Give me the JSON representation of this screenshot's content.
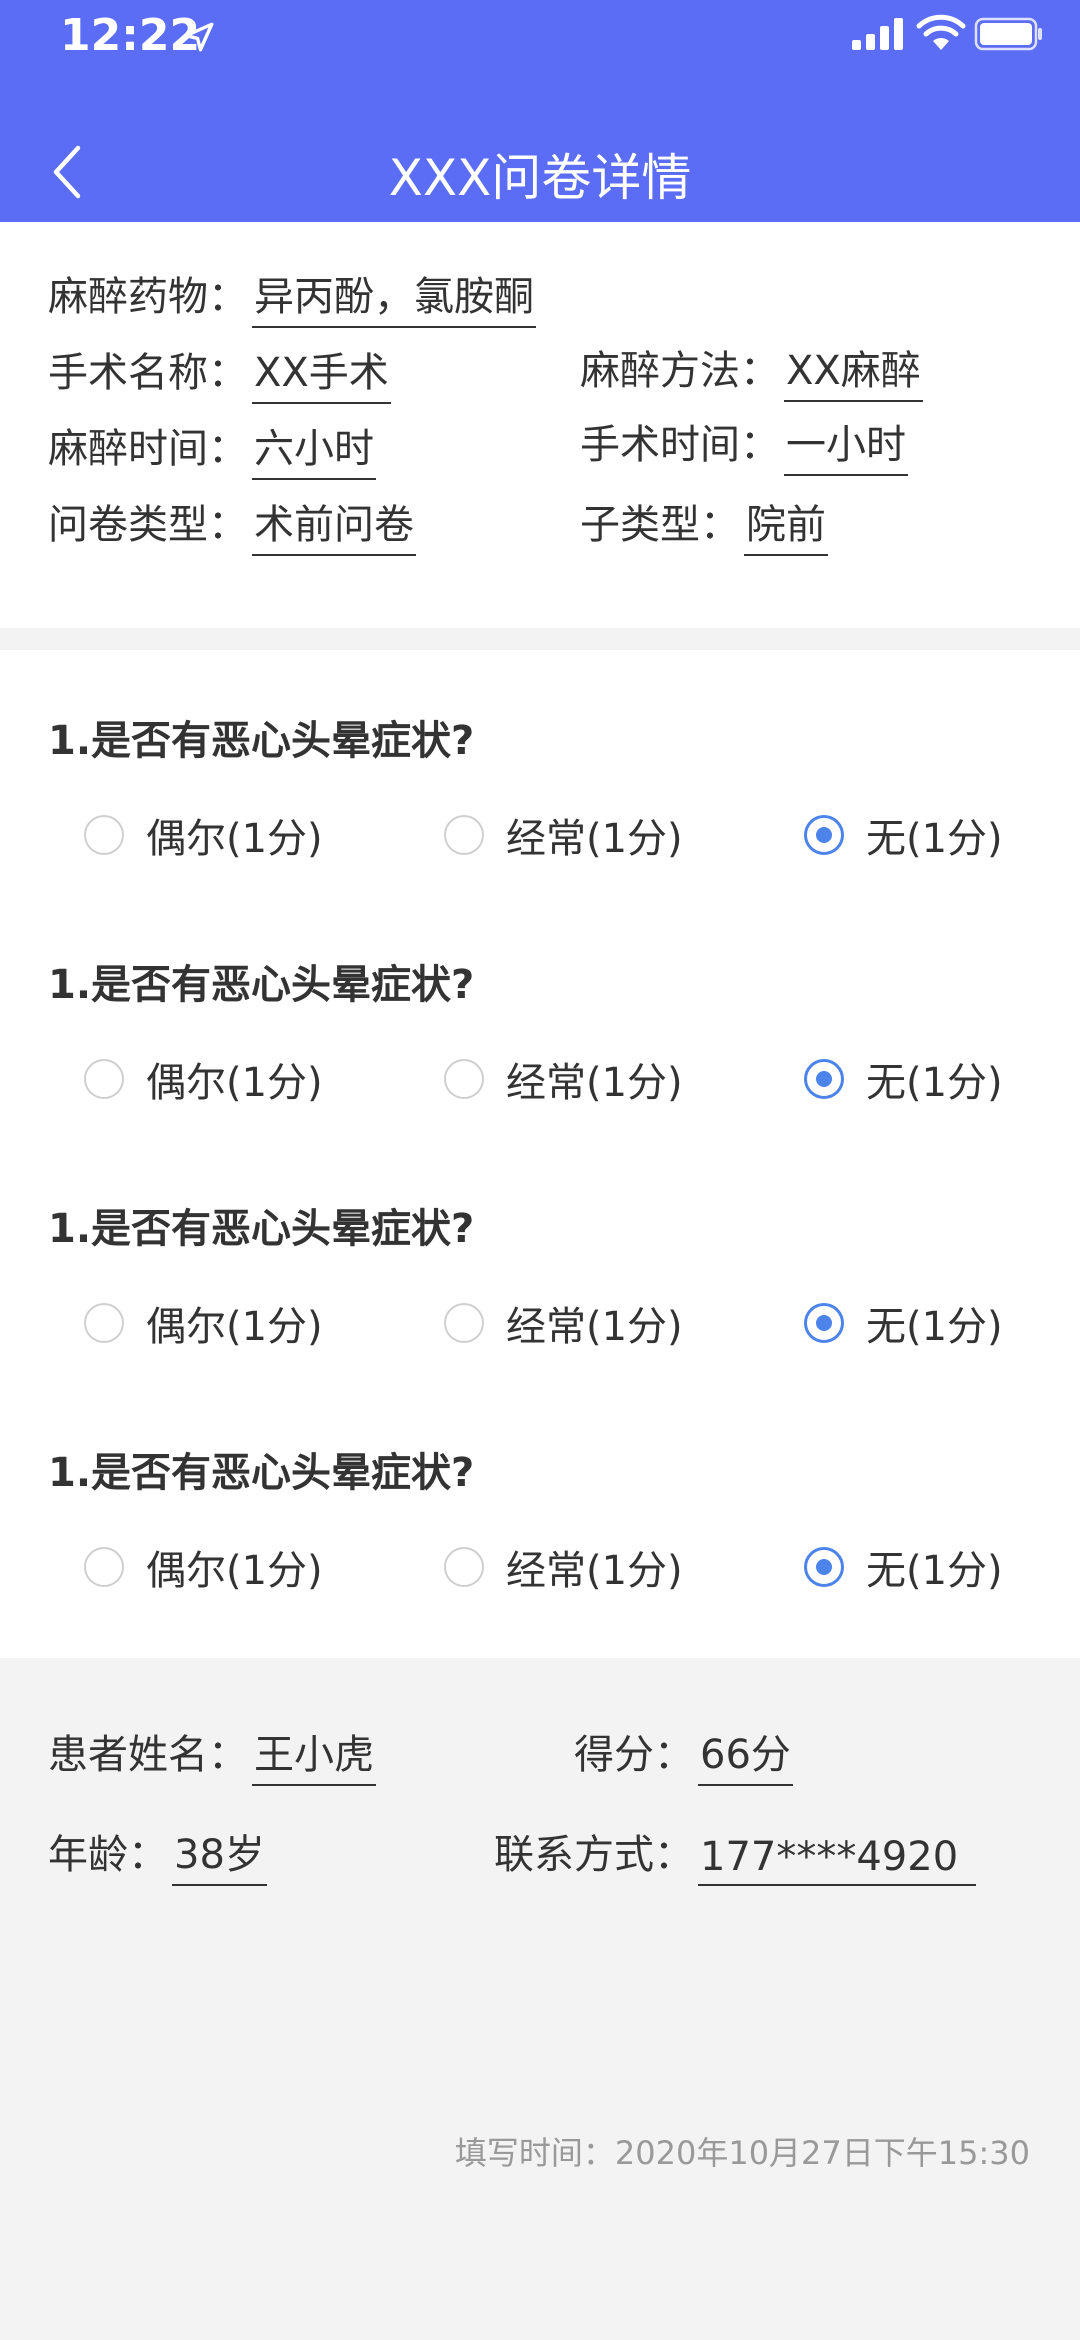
{
  "status_bar": {
    "time": "12:22"
  },
  "header": {
    "title": "XXX问卷详情"
  },
  "info": {
    "drug": {
      "label": "麻醉药物：",
      "value": "异丙酚，氯胺酮"
    },
    "surgery_name": {
      "label": "手术名称：",
      "value": "XX手术"
    },
    "anesthesia_method": {
      "label": "麻醉方法：",
      "value": "XX麻醉"
    },
    "anesthesia_time": {
      "label": "麻醉时间：",
      "value": "六小时"
    },
    "surgery_time": {
      "label": "手术时间：",
      "value": "一小时"
    },
    "questionnaire_type": {
      "label": "问卷类型：",
      "value": "术前问卷"
    },
    "subtype": {
      "label": "子类型：",
      "value": "院前"
    }
  },
  "questions": [
    {
      "text": "1.是否有恶心头晕症状?",
      "options": [
        "偶尔(1分)",
        "经常(1分)",
        "无(1分)"
      ],
      "selected": 2
    },
    {
      "text": "1.是否有恶心头晕症状?",
      "options": [
        "偶尔(1分)",
        "经常(1分)",
        "无(1分)"
      ],
      "selected": 2
    },
    {
      "text": "1.是否有恶心头晕症状?",
      "options": [
        "偶尔(1分)",
        "经常(1分)",
        "无(1分)"
      ],
      "selected": 2
    },
    {
      "text": "1.是否有恶心头晕症状?",
      "options": [
        "偶尔(1分)",
        "经常(1分)",
        "无(1分)"
      ],
      "selected": 2
    }
  ],
  "patient": {
    "name": {
      "label": "患者姓名：",
      "value": "王小虎"
    },
    "score": {
      "label": "得分：",
      "value": "66分"
    },
    "age": {
      "label": "年龄：",
      "value": "38岁"
    },
    "contact": {
      "label": "联系方式：",
      "value": "177****4920"
    }
  },
  "fill_time": "填写时间：2020年10月27日下午15:30",
  "colors": {
    "header": "#5b6cf5",
    "radio_active": "#4c84ec",
    "background": "#f3f3f3"
  }
}
